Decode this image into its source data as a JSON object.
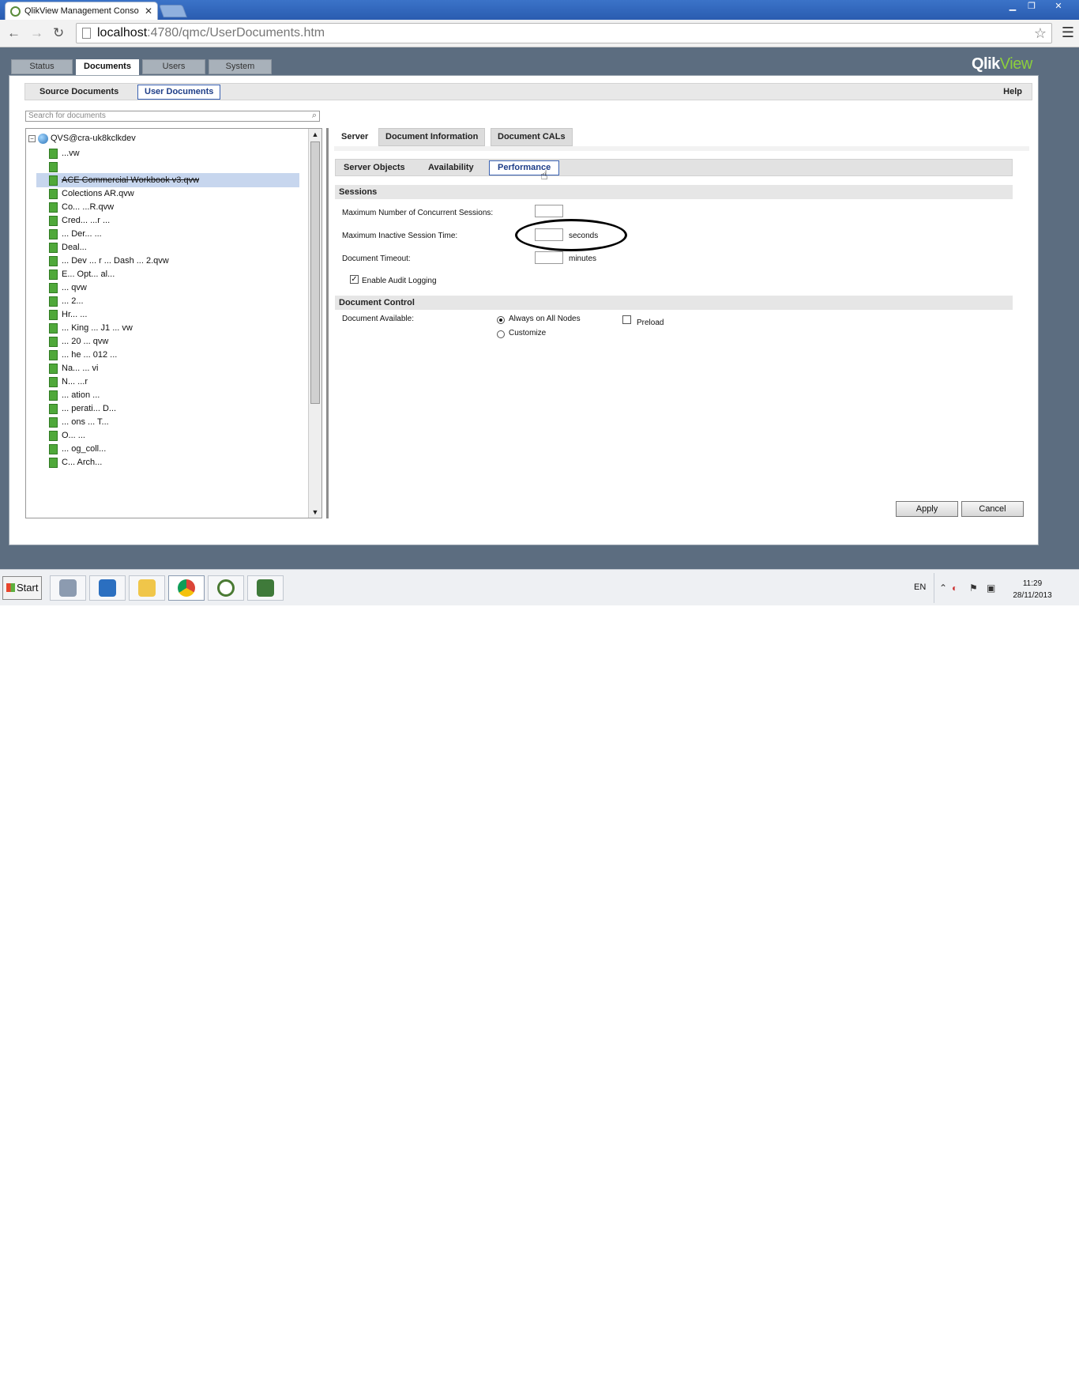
{
  "browser": {
    "tab_title": "QlikView Management Conso",
    "url_host": "localhost",
    "url_rest": ":4780/qmc/UserDocuments.htm"
  },
  "qmc": {
    "brand_part1": "Qlik",
    "brand_part2": "View",
    "main_tabs": [
      {
        "label": "Status"
      },
      {
        "label": "Documents"
      },
      {
        "label": "Users"
      },
      {
        "label": "System"
      }
    ],
    "sub_tabs": [
      {
        "label": "Source Documents"
      },
      {
        "label": "User Documents"
      }
    ],
    "help_label": "Help",
    "search_placeholder": "Search for documents",
    "tree": {
      "root_label": "QVS@cra-uk8kclkdev",
      "items": [
        {
          "label": "...vw"
        },
        {
          "label": ""
        },
        {
          "label": "ACE Commercial Workbook v3.qvw"
        },
        {
          "label": "Colections AR.qvw"
        },
        {
          "label": "Co... ...R.qvw"
        },
        {
          "label": "Cred... ...r ..."
        },
        {
          "label": "... Der... ..."
        },
        {
          "label": "Deal..."
        },
        {
          "label": "... Dev ... r ... Dash ... 2.qvw"
        },
        {
          "label": "E... Opt... al..."
        },
        {
          "label": "... qvw"
        },
        {
          "label": "... 2..."
        },
        {
          "label": "Hr... ..."
        },
        {
          "label": "... King ... J1 ... vw"
        },
        {
          "label": "... 20 ... qvw"
        },
        {
          "label": "... he ... 012 ..."
        },
        {
          "label": "Na... ... vi"
        },
        {
          "label": "N... ...r"
        },
        {
          "label": "... ation ..."
        },
        {
          "label": "... perati... D..."
        },
        {
          "label": "... ons ... T..."
        },
        {
          "label": "O... ..."
        },
        {
          "label": "... og_coll..."
        },
        {
          "label": "C... Arch..."
        }
      ]
    },
    "detail": {
      "top_tabs": [
        {
          "label": "Server"
        },
        {
          "label": "Document Information"
        },
        {
          "label": "Document CALs"
        }
      ],
      "perf_tabs": [
        {
          "label": "Server Objects"
        },
        {
          "label": "Availability"
        },
        {
          "label": "Performance"
        }
      ],
      "sessions_header": "Sessions",
      "max_concurrent_label": "Maximum Number of Concurrent Sessions:",
      "max_concurrent_value": "",
      "max_inactive_label": "Maximum Inactive Session Time:",
      "max_inactive_value": "",
      "max_inactive_unit": "seconds",
      "doc_timeout_label": "Document Timeout:",
      "doc_timeout_value": "",
      "doc_timeout_unit": "minutes",
      "audit_label": "Enable Audit Logging",
      "audit_checked": true,
      "doc_control_header": "Document Control",
      "doc_available_label": "Document Available:",
      "always_on_label": "Always on All Nodes",
      "customize_label": "Customize",
      "preload_label": "Preload",
      "apply_label": "Apply",
      "cancel_label": "Cancel"
    }
  },
  "taskbar": {
    "start_label": "Start",
    "lang": "EN",
    "time": "11:29",
    "date": "28/11/2013"
  }
}
